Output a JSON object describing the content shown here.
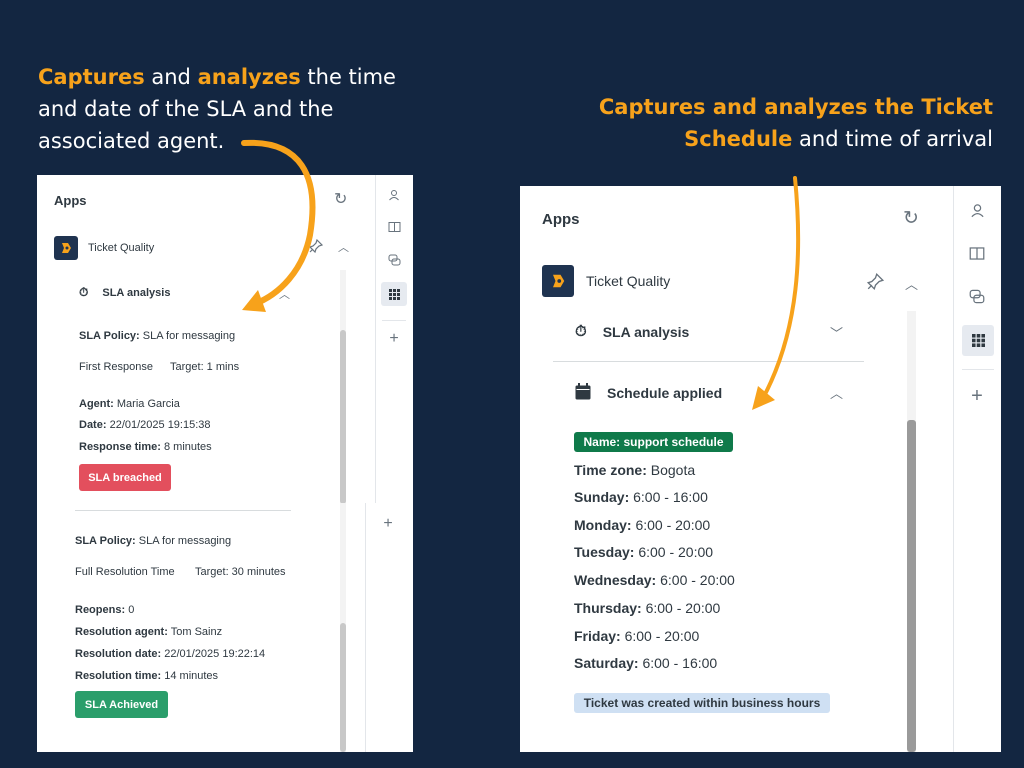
{
  "captions": {
    "left": {
      "hl1": "Captures",
      "t1": " and ",
      "hl2": "analyzes",
      "t2": " the time and date of the SLA and the associated agent."
    },
    "right": {
      "hl1": "Captures and analyzes the Ticket Schedule",
      "t1": " and time of arrival"
    }
  },
  "colors": {
    "background": "#132641",
    "highlight": "#f7a21b",
    "breached": "#e34f5d",
    "achieved": "#2b9e6b",
    "schedule_badge": "#0f7a4a",
    "info_badge": "#cfe0f3"
  },
  "left_panel": {
    "apps_title": "Apps",
    "app_name": "Ticket Quality",
    "section_title": "SLA analysis",
    "first_policy": {
      "policy_label": "SLA Policy:",
      "policy_value": "SLA for messaging",
      "metric": "First Response",
      "target": "Target: 1 mins",
      "agent_label": "Agent:",
      "agent_value": "Maria Garcia",
      "date_label": "Date:",
      "date_value": "22/01/2025 19:15:38",
      "response_label": "Response time:",
      "response_value": "8 minutes",
      "status": "SLA breached"
    },
    "second_policy": {
      "policy_label": "SLA Policy:",
      "policy_value": "SLA for messaging",
      "metric": "Full Resolution Time",
      "target": "Target: 30 minutes",
      "reopens_label": "Reopens:",
      "reopens_value": "0",
      "agent_label": "Resolution agent:",
      "agent_value": "Tom Sainz",
      "date_label": "Resolution date:",
      "date_value": "22/01/2025 19:22:14",
      "time_label": "Resolution time:",
      "time_value": "14 minutes",
      "status": "SLA Achieved"
    },
    "rail_icons": [
      "user-icon",
      "book-icon",
      "chat-icon",
      "apps-grid-icon",
      "plus-icon"
    ]
  },
  "right_panel": {
    "apps_title": "Apps",
    "app_name": "Ticket Quality",
    "sla_section": "SLA analysis",
    "schedule_section": "Schedule applied",
    "schedule_name": "Name: support schedule",
    "timezone_label": "Time zone:",
    "timezone_value": "Bogota",
    "days": [
      {
        "day": "Sunday:",
        "hours": "6:00 - 16:00"
      },
      {
        "day": "Monday:",
        "hours": "6:00 - 20:00"
      },
      {
        "day": "Tuesday:",
        "hours": "6:00 - 20:00"
      },
      {
        "day": "Wednesday:",
        "hours": "6:00 - 20:00"
      },
      {
        "day": "Thursday:",
        "hours": "6:00 - 20:00"
      },
      {
        "day": "Friday:",
        "hours": "6:00 - 20:00"
      },
      {
        "day": "Saturday:",
        "hours": "6:00 - 16:00"
      }
    ],
    "arrival_status": "Ticket was created within business hours",
    "rail_icons": [
      "user-icon",
      "book-icon",
      "chat-icon",
      "apps-grid-icon",
      "plus-icon"
    ]
  }
}
